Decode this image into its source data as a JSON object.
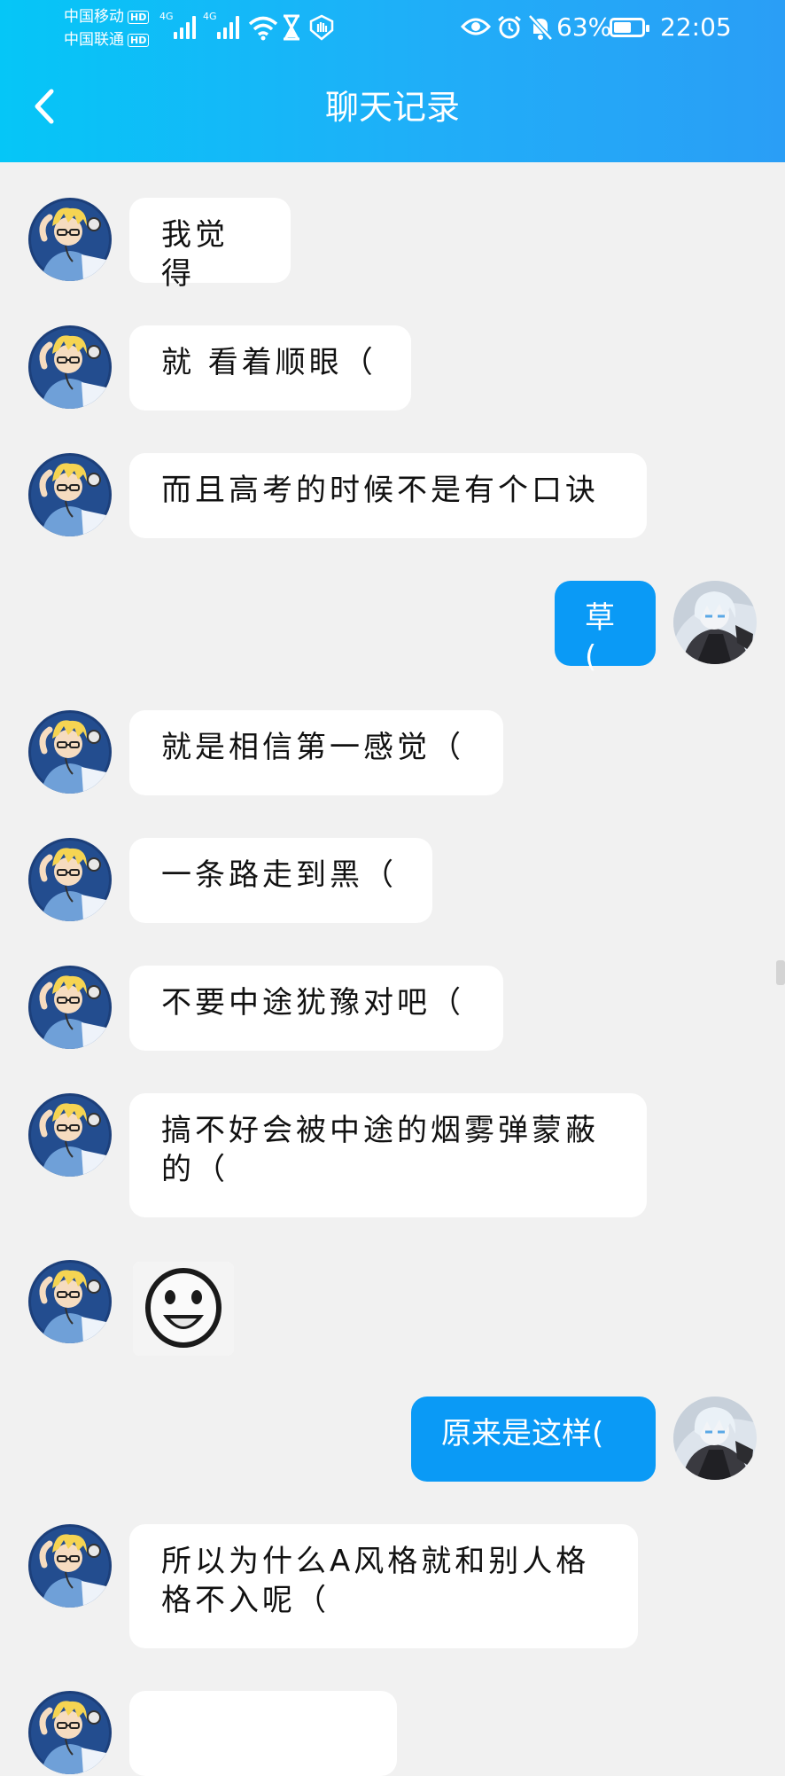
{
  "status_bar": {
    "carrier1": "中国移动",
    "carrier2": "中国联通",
    "hd": "HD",
    "network": "4G",
    "battery": "63%",
    "battery_level": 0.63,
    "time": "22:05",
    "icons": [
      "wifi-icon",
      "hourglass-icon",
      "shield-hand-icon",
      "eye-icon",
      "alarm-icon",
      "bell-off-icon"
    ]
  },
  "header": {
    "title": "聊天记录",
    "back_icon": "chevron-left-icon"
  },
  "colors": {
    "header_start": "#05c6f7",
    "header_end": "#2a9ef6",
    "my_bubble": "#0a9af6",
    "other_bubble": "#ffffff",
    "background": "#f1f1f1"
  },
  "messages": [
    {
      "from": "other",
      "text": "我觉得"
    },
    {
      "from": "other",
      "text": "就 看着顺眼（"
    },
    {
      "from": "other",
      "text": "而且高考的时候不是有个口诀"
    },
    {
      "from": "me",
      "text": "草("
    },
    {
      "from": "other",
      "text": "就是相信第一感觉（"
    },
    {
      "from": "other",
      "text": "一条路走到黑（"
    },
    {
      "from": "other",
      "text": "不要中途犹豫对吧（"
    },
    {
      "from": "other",
      "text_line1": "搞不好会被中途的烟雾弹蒙蔽",
      "text_line2": "的（"
    },
    {
      "from": "other",
      "sticker": "smiley-face-sticker"
    },
    {
      "from": "me",
      "text": "原来是这样("
    },
    {
      "from": "other",
      "text_line1": "所以为什么A风格就和别人格",
      "text_line2": "格不入呢（"
    }
  ]
}
